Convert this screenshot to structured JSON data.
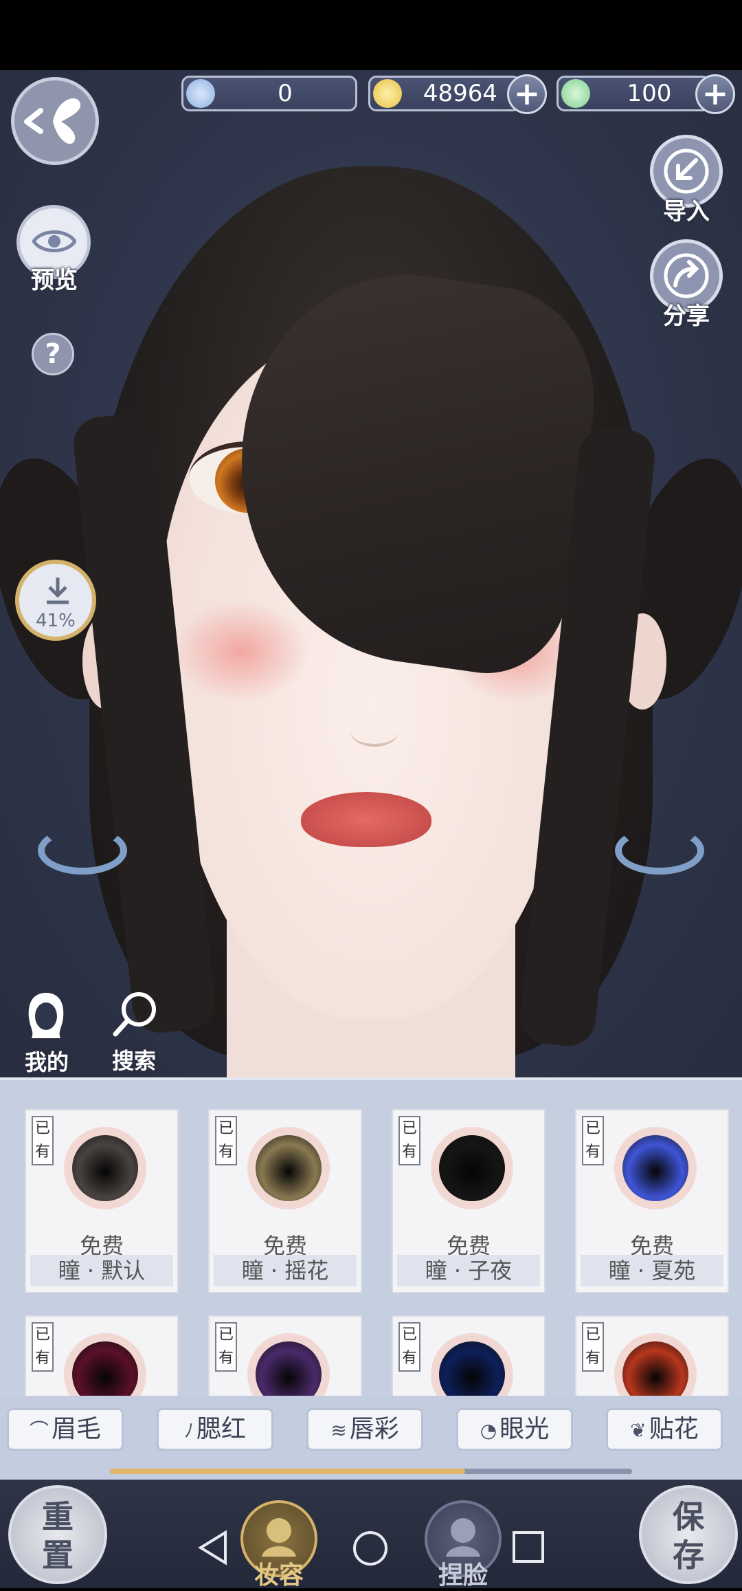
{
  "currencies": [
    {
      "name": "silver-feather",
      "value": "0",
      "has_plus": false,
      "color": "#8fb2e0"
    },
    {
      "name": "copper-coin",
      "value": "48964",
      "has_plus": true,
      "color": "#e6c046"
    },
    {
      "name": "jade-token",
      "value": "100",
      "has_plus": true,
      "color": "#7fd08a"
    }
  ],
  "left_controls": {
    "preview_label": "预览",
    "download_progress": "41%",
    "mine_label": "我的",
    "search_label": "搜索"
  },
  "right_controls": {
    "import_label": "导入",
    "share_label": "分享"
  },
  "catalog": {
    "owned_tag": "已有",
    "row1": [
      {
        "price": "免费",
        "name": "瞳 · 默认",
        "color": "#4a4440"
      },
      {
        "price": "免费",
        "name": "瞳 · 摇花",
        "color": "#8a7a52"
      },
      {
        "price": "免费",
        "name": "瞳 · 子夜",
        "color": "#151515"
      },
      {
        "price": "免费",
        "name": "瞳 · 夏苑",
        "color": "#3f55d6"
      }
    ],
    "row2_colors": [
      "#5a1028",
      "#4a2a6a",
      "#0e1f5a",
      "#b6361e"
    ]
  },
  "tabs": [
    {
      "icon": "brow-icon",
      "glyph": "⌒",
      "label": "眉毛"
    },
    {
      "icon": "blush-icon",
      "glyph": "ﾉ",
      "label": "腮红"
    },
    {
      "icon": "lips-icon",
      "glyph": "≋",
      "label": "唇彩"
    },
    {
      "icon": "eye-light-icon",
      "glyph": "◔",
      "label": "眼光"
    },
    {
      "icon": "sticker-icon",
      "glyph": "❦",
      "label": "贴花"
    }
  ],
  "scroll_progress": 0.68,
  "bottom_bar": {
    "reset_label": "重\n置",
    "save_label": "保\n存",
    "makeup_label": "妆容",
    "face_label": "捏脸"
  },
  "accent_gold": "#d4b26a"
}
